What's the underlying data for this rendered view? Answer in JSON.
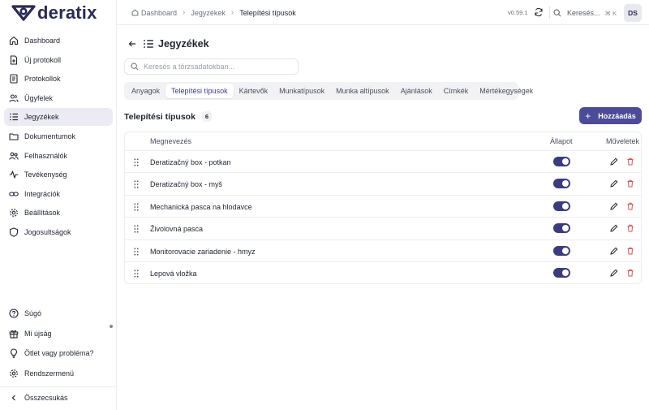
{
  "brand": {
    "name": "deratix",
    "accent": "#4b4b98"
  },
  "sidebar": {
    "items": [
      {
        "label": "Dashboard",
        "icon": "home-icon"
      },
      {
        "label": "Új protokoll",
        "icon": "file-plus-icon"
      },
      {
        "label": "Protokollok",
        "icon": "document-icon"
      },
      {
        "label": "Ügyfelek",
        "icon": "users-icon"
      },
      {
        "label": "Jegyzékek",
        "icon": "list-icon",
        "active": true
      },
      {
        "label": "Dokumentumok",
        "icon": "folder-icon"
      },
      {
        "label": "Felhasználók",
        "icon": "user-group-icon"
      },
      {
        "label": "Tevékenység",
        "icon": "activity-icon"
      },
      {
        "label": "Integrációk",
        "icon": "link-icon"
      },
      {
        "label": "Beállítások",
        "icon": "gear-icon"
      },
      {
        "label": "Jogosultságok",
        "icon": "shield-icon"
      }
    ],
    "bottom": [
      {
        "label": "Súgó",
        "icon": "help-icon"
      },
      {
        "label": "Mi újság",
        "icon": "gift-icon"
      },
      {
        "label": "Ötlet vagy probléma?",
        "icon": "lightbulb-icon"
      },
      {
        "label": "Rendszermenü",
        "icon": "gear-icon"
      }
    ],
    "collapse_label": "Összecsukás"
  },
  "topbar": {
    "breadcrumb": [
      "Dashboard",
      "Jegyzékek",
      "Telepítési típusok"
    ],
    "version": "v0.59.1",
    "search_label": "Keresés...",
    "shortcut": "⌘ K",
    "avatar_initials": "DS"
  },
  "main": {
    "title": "Jegyzékek",
    "search_placeholder": "Keresés a törzsadatokban...",
    "tabs": [
      {
        "label": "Anyagok"
      },
      {
        "label": "Telepítési típusok",
        "active": true
      },
      {
        "label": "Kártevők"
      },
      {
        "label": "Munkatípusok"
      },
      {
        "label": "Munka altípusok"
      },
      {
        "label": "Ajánlások"
      },
      {
        "label": "Címkék"
      },
      {
        "label": "Mértékegységek"
      }
    ],
    "section_title": "Telepítési típusok",
    "count": "6",
    "add_label": "Hozzáadás",
    "table": {
      "headers": {
        "name": "Megnevezés",
        "status": "Állapot",
        "actions": "Műveletek"
      },
      "rows": [
        {
          "name": "Deratizačný box - potkan",
          "enabled": true
        },
        {
          "name": "Deratizačný box - myš",
          "enabled": true
        },
        {
          "name": "Mechanická pasca na hlodavce",
          "enabled": true
        },
        {
          "name": "Živolovná pasca",
          "enabled": true
        },
        {
          "name": "Monitorovacie zariadenie - hmyz",
          "enabled": true
        },
        {
          "name": "Lepová vložka",
          "enabled": true
        }
      ]
    }
  }
}
